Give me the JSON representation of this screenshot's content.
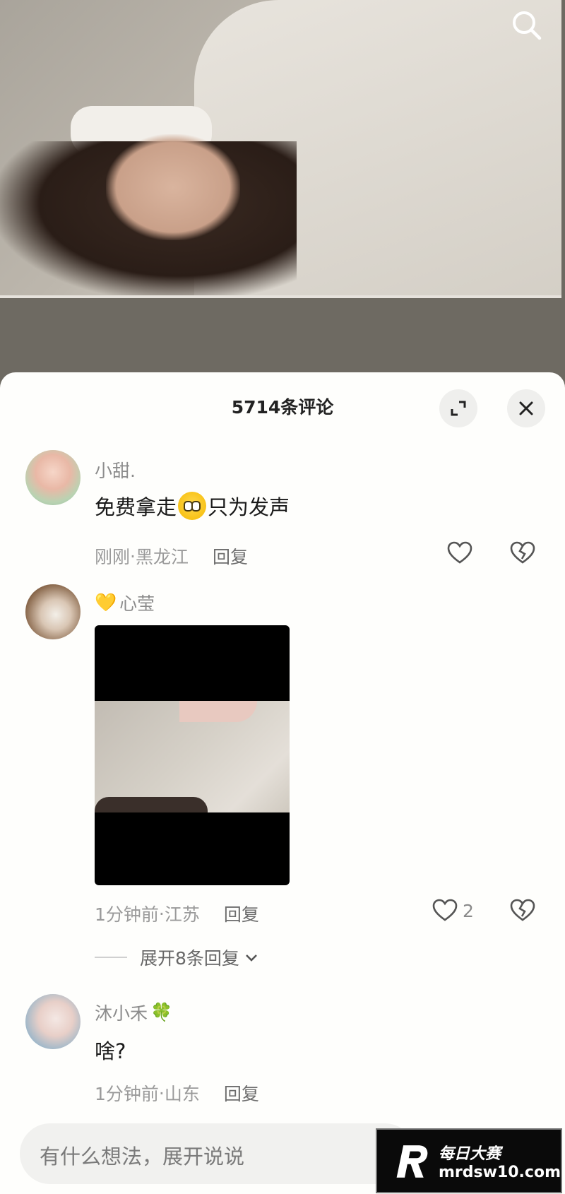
{
  "panel": {
    "title": "5714条评论"
  },
  "comments": [
    {
      "username": "小甜.",
      "content_before": "免费拿走",
      "content_after": "只为发声",
      "time": "刚刚",
      "location": "黑龙江",
      "reply_label": "回复",
      "like_count": ""
    },
    {
      "username_emoji": "💛",
      "username": "心莹",
      "time": "1分钟前",
      "location": "江苏",
      "reply_label": "回复",
      "like_count": "2",
      "expand_label": "展开8条回复"
    },
    {
      "username": "沐小禾",
      "username_emoji": "🍀",
      "content": "啥?",
      "time": "1分钟前",
      "location": "山东",
      "reply_label": "回复"
    }
  ],
  "meta_separator": " · ",
  "input": {
    "placeholder": "有什么想法，展开说说"
  },
  "watermark": {
    "brand": "每日大赛",
    "url": "mrdsw10.com"
  },
  "icons": [
    "search-icon",
    "expand-icon",
    "close-icon",
    "heart-icon",
    "heart-broken-icon",
    "chevron-down-icon"
  ]
}
